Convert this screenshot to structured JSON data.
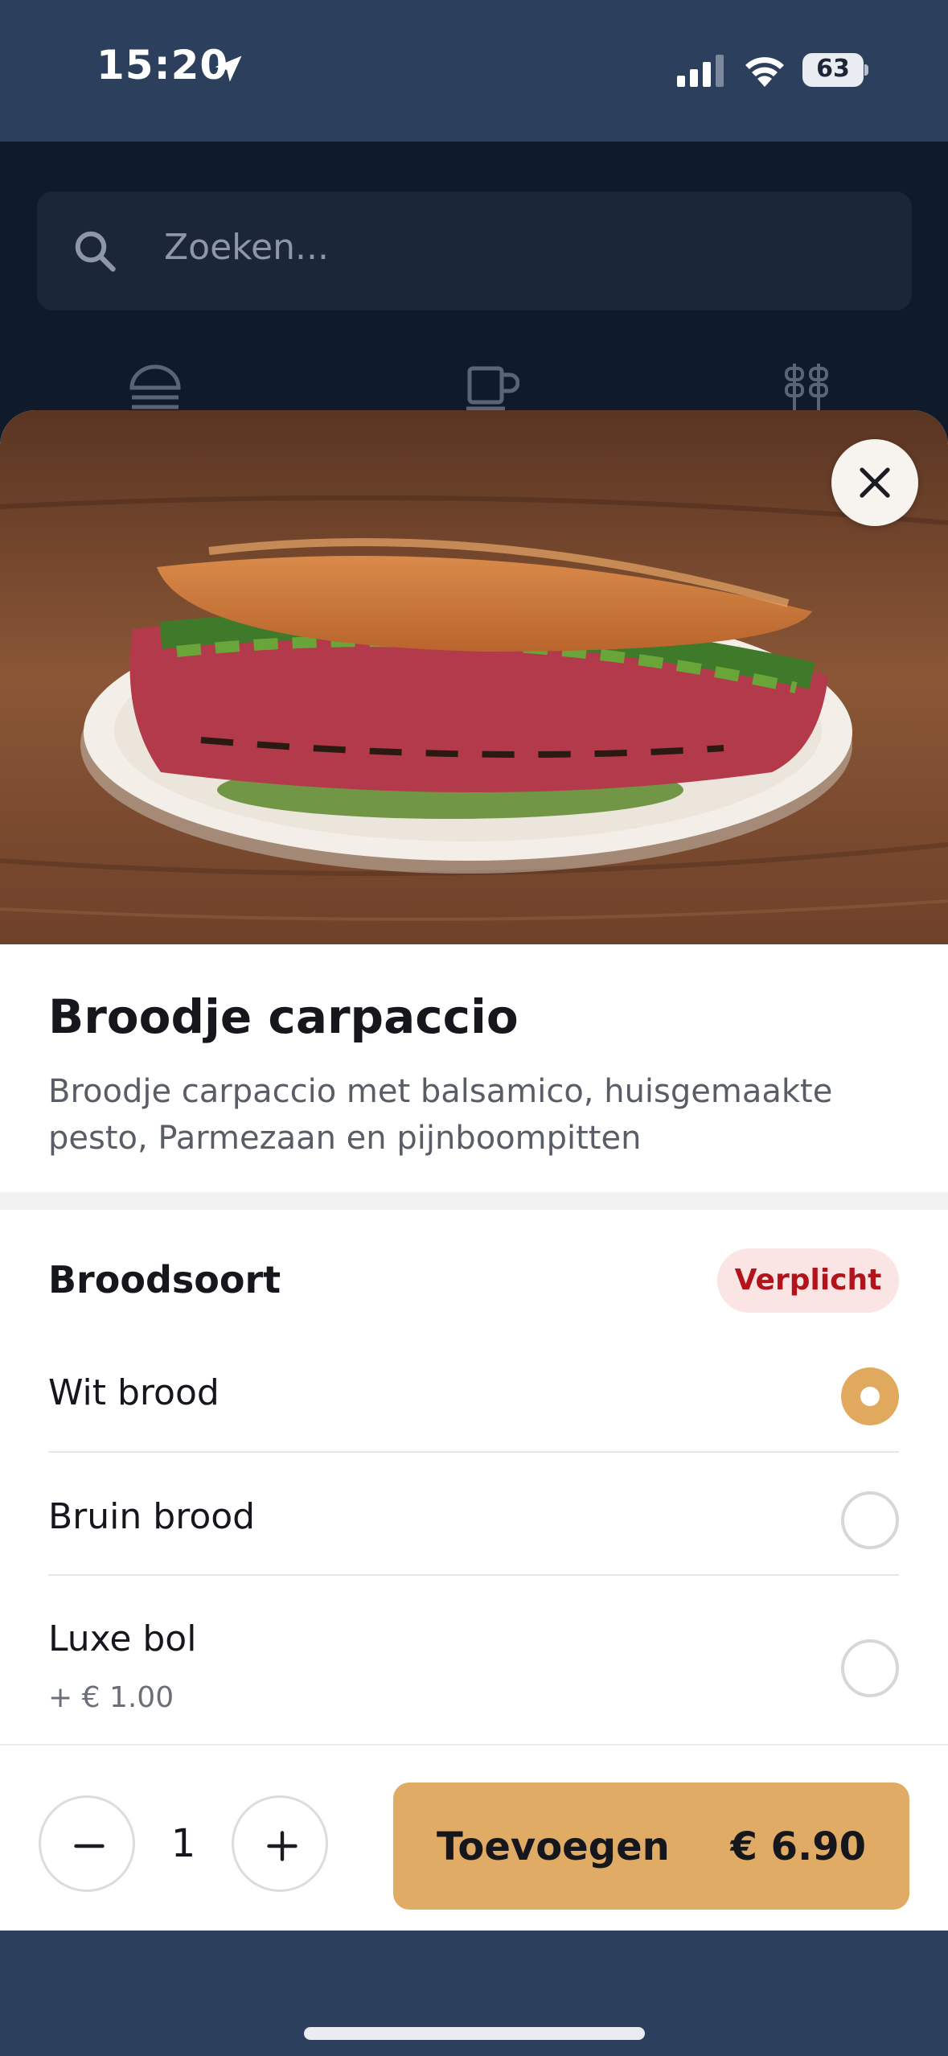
{
  "status_bar": {
    "time": "15:20",
    "battery": "63",
    "icons": [
      "location-arrow-icon",
      "cellular-signal-icon",
      "wifi-icon",
      "battery-icon"
    ]
  },
  "background": {
    "search_placeholder": "Zoeken...",
    "category_icons": [
      "burger-icon",
      "coffee-cup-icon",
      "skewer-icon"
    ]
  },
  "product": {
    "image": "sandwich-photo",
    "title": "Broodje carpaccio",
    "description": "Broodje carpaccio met balsamico, huisgemaakte pesto, Parmezaan en pijnboompitten"
  },
  "options_group": {
    "title": "Broodsoort",
    "badge": "Verplicht",
    "options": [
      {
        "label": "Wit brood",
        "extra": "",
        "selected": true
      },
      {
        "label": "Bruin brood",
        "extra": "",
        "selected": false
      },
      {
        "label": "Luxe bol",
        "extra": "+ € 1.00",
        "selected": false
      }
    ]
  },
  "footer": {
    "quantity": "1",
    "add_label": "Toevoegen",
    "price": "€ 6.90"
  },
  "colors": {
    "accent": "#e0ab64",
    "badge_bg": "#fbe4e4",
    "badge_text": "#b3141c",
    "nav_bg": "#2c3f5d",
    "app_bg": "#0f1a2a"
  }
}
